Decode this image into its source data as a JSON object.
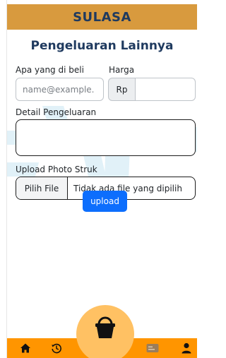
{
  "app": {
    "title": "SULASA"
  },
  "page": {
    "title": "Pengeluaran Lainnya"
  },
  "form": {
    "item_label": "Apa yang di beli",
    "item_placeholder": "name@example.",
    "price_label": "Harga",
    "price_prefix": "Rp",
    "price_value": "",
    "detail_label": "Detail Pengeluaran",
    "detail_value": "",
    "photo_label": "Upload Photo Struk",
    "file_button_label": "Pilih File",
    "file_status": "Tidak ada file yang dipilih",
    "upload_label": "upload"
  },
  "bottom_nav": {
    "items": [
      {
        "icon": "home-icon"
      },
      {
        "icon": "history-icon"
      },
      {
        "icon": "basket-icon"
      },
      {
        "icon": "card-icon"
      },
      {
        "icon": "user-icon"
      }
    ]
  },
  "colors": {
    "header_bg": "#d89a3e",
    "title_text": "#1f3a5f",
    "bottom_bar": "#ff9500",
    "center_button": "#ffc163",
    "primary_button": "#0d6efd"
  }
}
